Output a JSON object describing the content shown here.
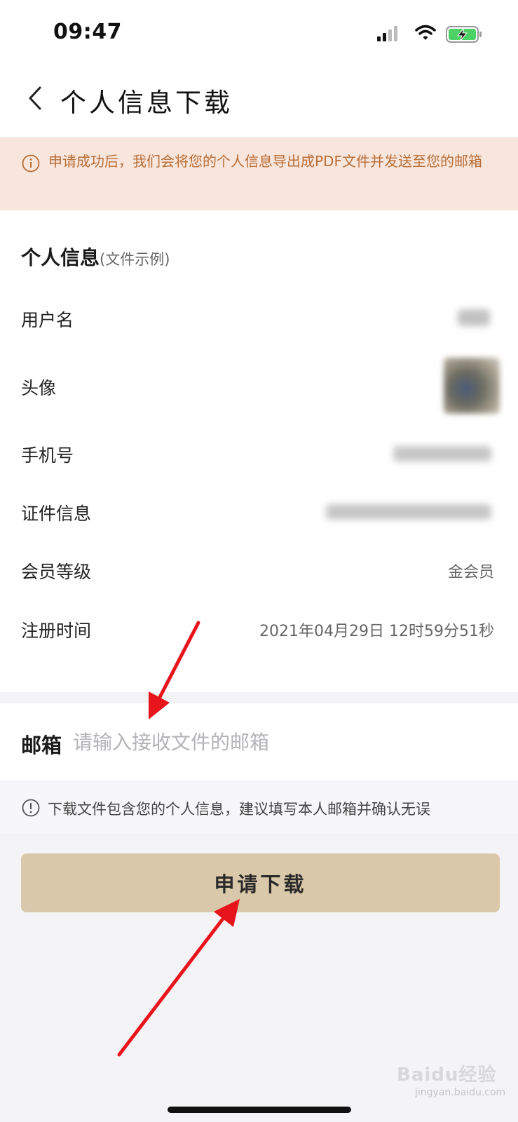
{
  "status_bar": {
    "time": "09:47",
    "icons": [
      "signal-icon",
      "wifi-icon",
      "battery-charging-icon"
    ]
  },
  "nav": {
    "back_icon": "chevron-left-icon",
    "title": "个人信息下载"
  },
  "notice": {
    "icon": "info-icon",
    "text": "申请成功后，我们会将您的个人信息导出成PDF文件并发送至您的邮箱"
  },
  "info": {
    "title": "个人信息",
    "subtitle": "(文件示例)",
    "rows": [
      {
        "label": "用户名",
        "value": ""
      },
      {
        "label": "头像",
        "value": ""
      },
      {
        "label": "手机号",
        "value": ""
      },
      {
        "label": "证件信息",
        "value": ""
      },
      {
        "label": "会员等级",
        "value": "金会员"
      },
      {
        "label": "注册时间",
        "value": "2021年04月29日  12时59分51秒"
      }
    ]
  },
  "email": {
    "label": "邮箱",
    "value": "",
    "placeholder": "请输入接收文件的邮箱"
  },
  "hint": {
    "icon": "info-icon",
    "text": "下载文件包含您的个人信息，建议填写本人邮箱并确认无误"
  },
  "apply_button": {
    "label": "申请下载"
  },
  "annotation": {
    "arrow_color": "#e8141b"
  },
  "watermark": {
    "logo": "Baidu经验",
    "url": "jingyan.baidu.com"
  },
  "colors": {
    "notice_bg": "#f8e5dc",
    "notice_text": "#b86e37",
    "button_bg": "#d9c8a9",
    "page_bg": "#f4f4f7"
  }
}
